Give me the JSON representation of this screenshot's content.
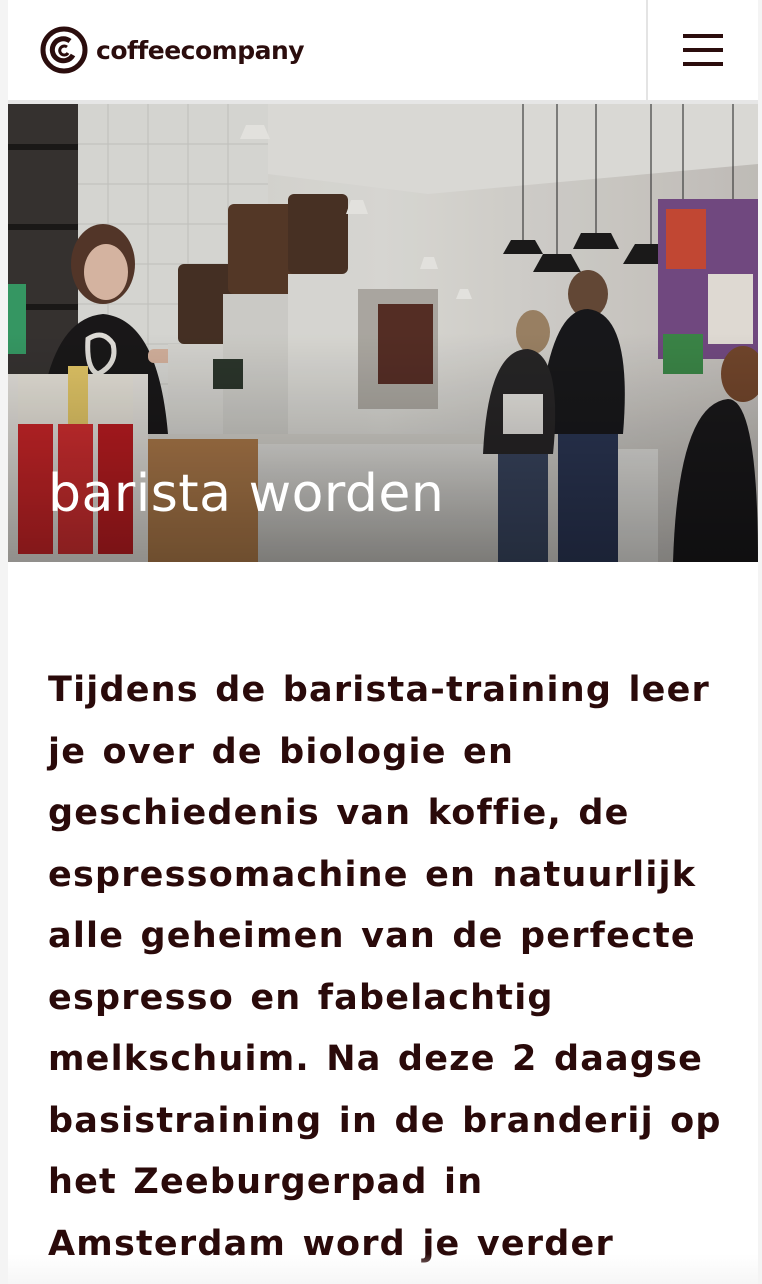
{
  "header": {
    "logo_text": "coffeecompany",
    "menu_icon": "hamburger-menu-icon"
  },
  "hero": {
    "title": "barista worden"
  },
  "intro": {
    "text": "Tijdens de barista-training leer je over de biologie en geschiedenis van koffie, de espressomachine en natuurlijk alle geheimen van de perfecte espresso en fabelachtig melkschuim. Na deze 2 daagse basistraining in de branderij op het Zeeburgerpad in Amsterdam word je verder"
  },
  "colors": {
    "brand_dark": "#2b0d0d",
    "background": "#ffffff",
    "hero_text": "#ffffff"
  }
}
